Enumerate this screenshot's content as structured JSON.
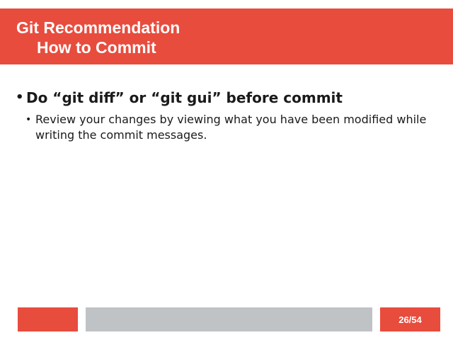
{
  "slide": {
    "title_line1": "Git Recommendation",
    "title_line2": "How to Commit",
    "bullets": [
      {
        "text": "Do “git diff” or “git gui” before commit",
        "sub": [
          {
            "text": "Review your changes by viewing what you have been modified while writing the commit messages."
          }
        ]
      }
    ]
  },
  "footer": {
    "page_number": "26/54"
  },
  "colors": {
    "accent": "#e84c3d",
    "footer_gray": "#c0c3c6",
    "text": "#1a1a1a"
  }
}
